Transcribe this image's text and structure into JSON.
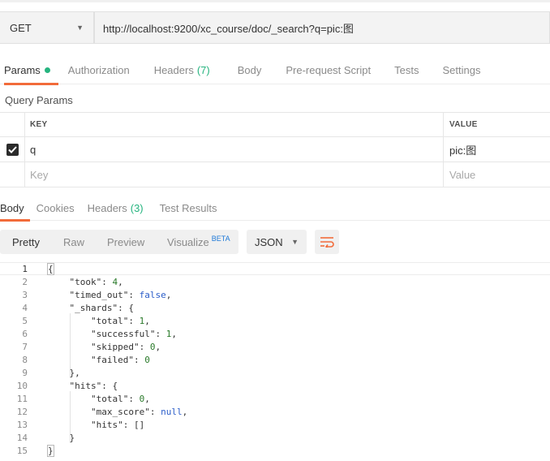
{
  "request": {
    "method": "GET",
    "url": "http://localhost:9200/xc_course/doc/_search?q=pic:图"
  },
  "request_tabs": [
    {
      "label": "Params",
      "active": true,
      "dot": true
    },
    {
      "label": "Authorization"
    },
    {
      "label": "Headers",
      "count": "(7)"
    },
    {
      "label": "Body"
    },
    {
      "label": "Pre-request Script"
    },
    {
      "label": "Tests"
    },
    {
      "label": "Settings"
    }
  ],
  "query_params": {
    "title": "Query Params",
    "columns": {
      "key": "KEY",
      "value": "VALUE"
    },
    "rows": [
      {
        "checked": true,
        "key": "q",
        "value": "pic:图"
      }
    ],
    "placeholder": {
      "key": "Key",
      "value": "Value"
    }
  },
  "response_tabs": [
    {
      "label": "Body",
      "active": true
    },
    {
      "label": "Cookies"
    },
    {
      "label": "Headers",
      "count": "(3)"
    },
    {
      "label": "Test Results"
    }
  ],
  "toolbar": {
    "views": [
      "Pretty",
      "Raw",
      "Preview",
      "Visualize"
    ],
    "beta": "BETA",
    "format": "JSON"
  },
  "response_body": {
    "line_numbers": [
      "1",
      "2",
      "3",
      "4",
      "5",
      "6",
      "7",
      "8",
      "9",
      "10",
      "11",
      "12",
      "13",
      "14",
      "15"
    ],
    "lines": [
      "{",
      "    \"took\": 4,",
      "    \"timed_out\": false,",
      "    \"_shards\": {",
      "        \"total\": 1,",
      "        \"successful\": 1,",
      "        \"skipped\": 0,",
      "        \"failed\": 0",
      "    },",
      "    \"hits\": {",
      "        \"total\": 0,",
      "        \"max_score\": null,",
      "        \"hits\": []",
      "    }",
      "}"
    ]
  }
}
